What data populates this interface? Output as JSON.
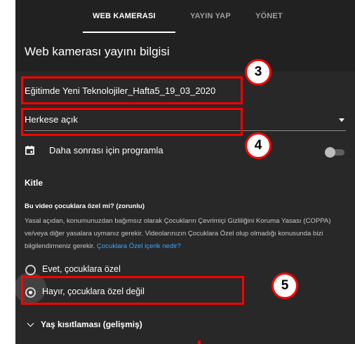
{
  "tabs": [
    {
      "label": "WEB KAMERASI",
      "active": true
    },
    {
      "label": "YAYIN YAP",
      "active": false
    },
    {
      "label": "YÖNET",
      "active": false
    }
  ],
  "page_title": "Web kamerası yayını bilgisi",
  "title_field": {
    "value": "Eğitimde Yeni Teknolojiler_Hafta5_19_03_2020"
  },
  "visibility": {
    "value": "Herkese açık"
  },
  "schedule": {
    "label": "Daha sonrası için programla",
    "icon": "calendar-icon",
    "toggle_on": false
  },
  "audience": {
    "section_title": "Kitle",
    "question": "Bu video çocuklara özel mi? (zorunlu)",
    "paragraph": "Yasal açıdan, konumunuzdan bağımsız olarak Çocukların Çevrimiçi Gizliliğini Koruma Yasası (COPPA) ve/veya diğer yasalara uymanız gerekir. Videolarınızın Çocuklara Özel olup olmadığı konusunda bizi bilgilendirmeniz gerekir.",
    "link": "Çocuklara Özel içerik nedir?",
    "options": [
      {
        "label": "Evet, çocuklara özel",
        "selected": false
      },
      {
        "label": "Hayır, çocuklara özel değil",
        "selected": true
      }
    ]
  },
  "age_restriction": {
    "label": "Yaş kısıtlaması (gelişmiş)",
    "icon": "chevron-down-icon"
  },
  "annotations": [
    "3",
    "4",
    "5"
  ],
  "colors": {
    "accent_red": "#ff0000",
    "panel_bg": "#282828",
    "header_bg": "#212121",
    "link": "#3ea6ff"
  }
}
